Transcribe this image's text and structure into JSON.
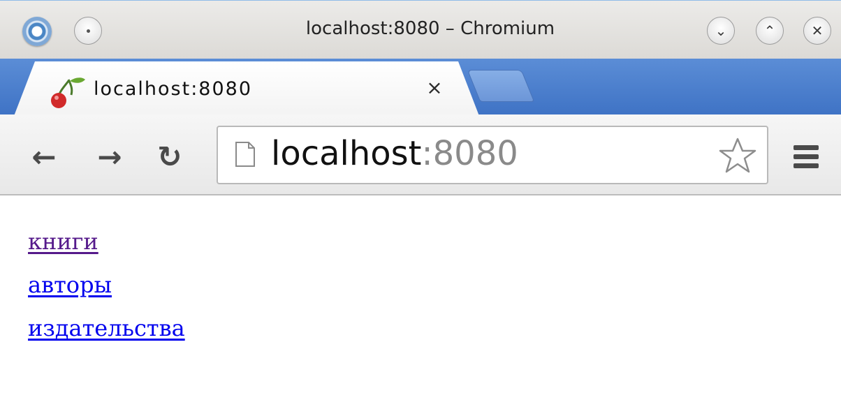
{
  "window": {
    "title": "localhost:8080 – Chromium"
  },
  "tab": {
    "title": "localhost:8080"
  },
  "toolbar": {
    "back_icon": "←",
    "forward_icon": "→",
    "reload_icon": "↻",
    "url_host": "localhost",
    "url_port": ":8080"
  },
  "links": [
    {
      "label": "книги",
      "visited": true
    },
    {
      "label": "авторы",
      "visited": false
    },
    {
      "label": "издательства",
      "visited": false
    }
  ]
}
